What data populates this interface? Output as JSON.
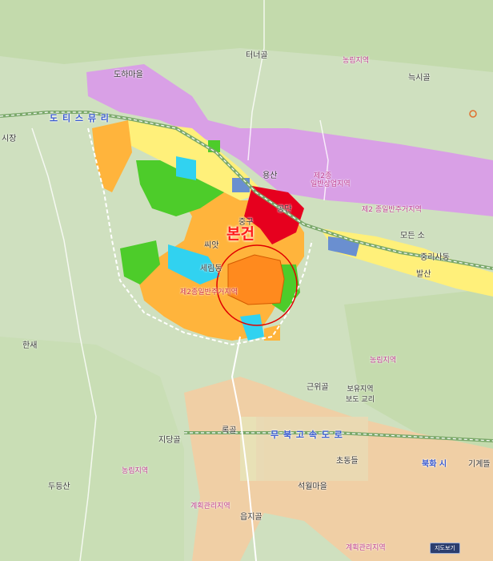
{
  "map": {
    "project_label": "본건",
    "labels": {
      "teoneol": "터너골",
      "forest_ne": "농림지역",
      "dohamaeul": "도하마을",
      "neuksaeol": "늑시골",
      "expressway_w": "도 티 스 뮤 리",
      "sijang": "시장",
      "yongsan": "용산",
      "commercial_zone_top": "제2종",
      "commercial_zone_bottom": "일반상업지역",
      "gongdan": "공단",
      "junggu": "중구",
      "ssiat": "씨앗",
      "jiyeok_plan": "제2 종일반주거지역",
      "road_e1": "모든 소",
      "road_e2": "중리사동",
      "balsan": "발산",
      "seorimdong": "세림동",
      "residential": "제2종일반주거지역",
      "hansae": "한새",
      "forest_center": "농림지역",
      "geunwigol": "근위골",
      "center_block": "보유지역 보도 교리",
      "rotgol": "록골",
      "jidangol": "지당골",
      "expressway_s": "무 북 고 속 도 로",
      "chondongdeul": "초동들",
      "bukhwa": "북화 시",
      "gigaetteul": "기계뜰",
      "forest_sw": "농림지역",
      "dudeungsan": "두등산",
      "seokwolmaeul": "석월마을",
      "planned_area": "계획관리지역",
      "eopjigol": "읍지골",
      "forest_s": "계획관리지역"
    },
    "button_label": "지도보기",
    "colors": {
      "forest": "#cfe0bf",
      "residential": "#ffb43c",
      "commercial": "#e6001e",
      "industrial_purple": "#d9a0e6",
      "green": "#4dcc2a",
      "cyan": "#31d2f0",
      "yellow_strip": "#fff07a",
      "project_fill": "#ff8a1e",
      "project_circle": "#e00000",
      "planned": "#f6cba0"
    }
  }
}
